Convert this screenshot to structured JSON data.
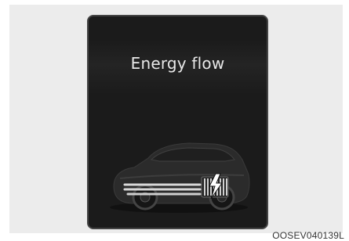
{
  "screen": {
    "title": "Energy flow"
  },
  "figure": {
    "code": "OOSEV040139L"
  },
  "icons": {
    "car": "electric-suv-icon",
    "energy": "lightning-bolt-icon"
  },
  "colors": {
    "screen_bg": "#1b1b1b",
    "title_text": "#e8e8e8",
    "flow_lines": "#d8d8d8"
  }
}
